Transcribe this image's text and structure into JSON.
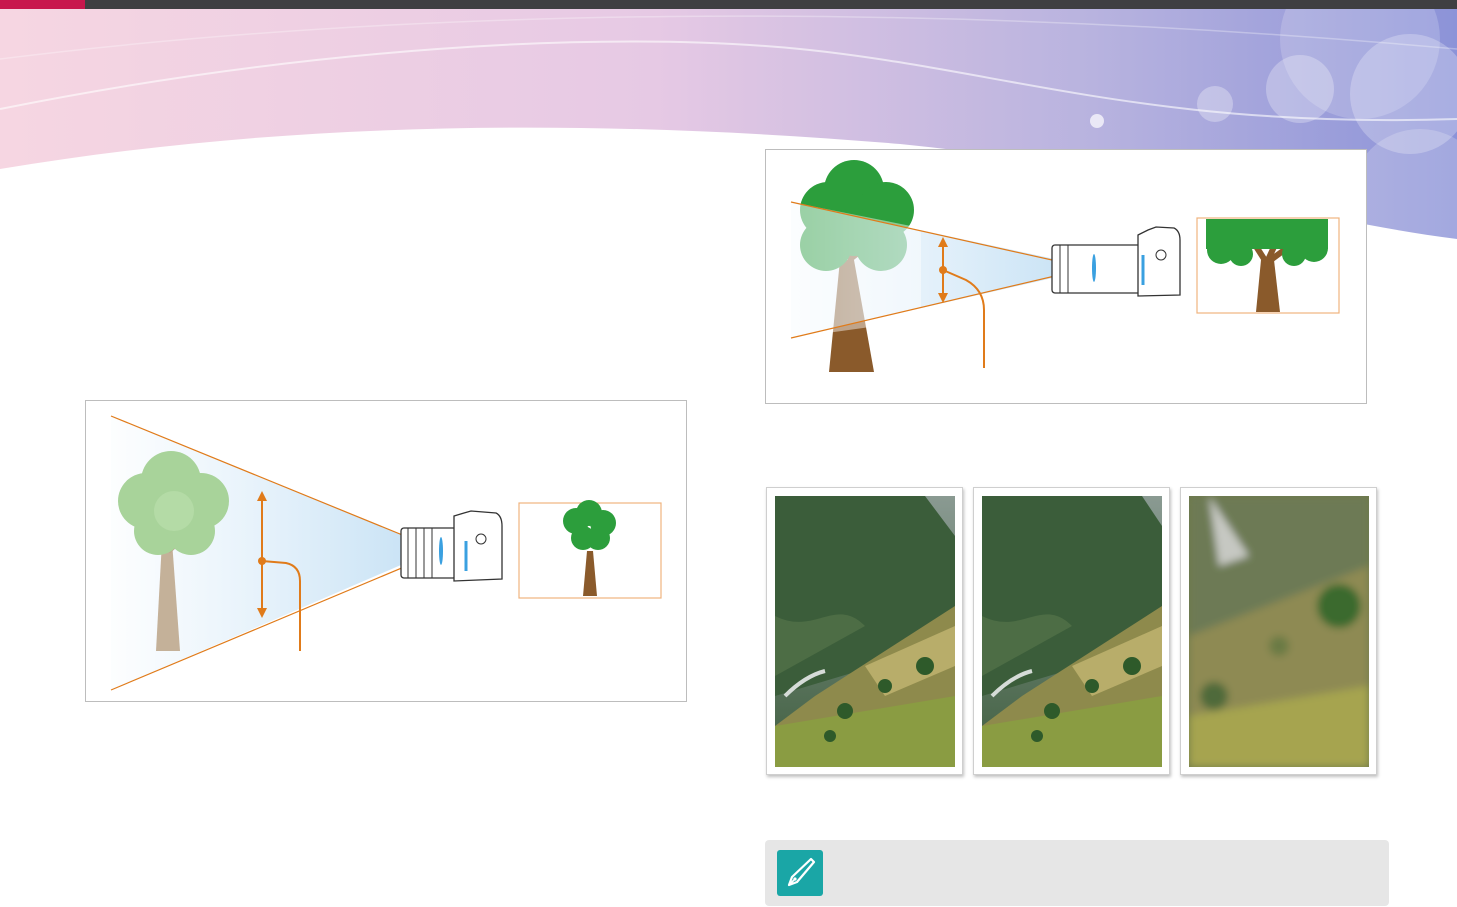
{
  "colors": {
    "accent": "#c8174d",
    "top_bar": "#3f3f42",
    "ray_line": "#e07b1a",
    "note_icon": "#1aa6a6",
    "note_background": "#e6e6e6"
  },
  "icons": {
    "note": "pen-nib-icon",
    "camera": "camera-icon",
    "tree": "tree-icon"
  },
  "photos": [
    {
      "focus": "sharp"
    },
    {
      "focus": "sharp"
    },
    {
      "focus": "blurred"
    }
  ]
}
